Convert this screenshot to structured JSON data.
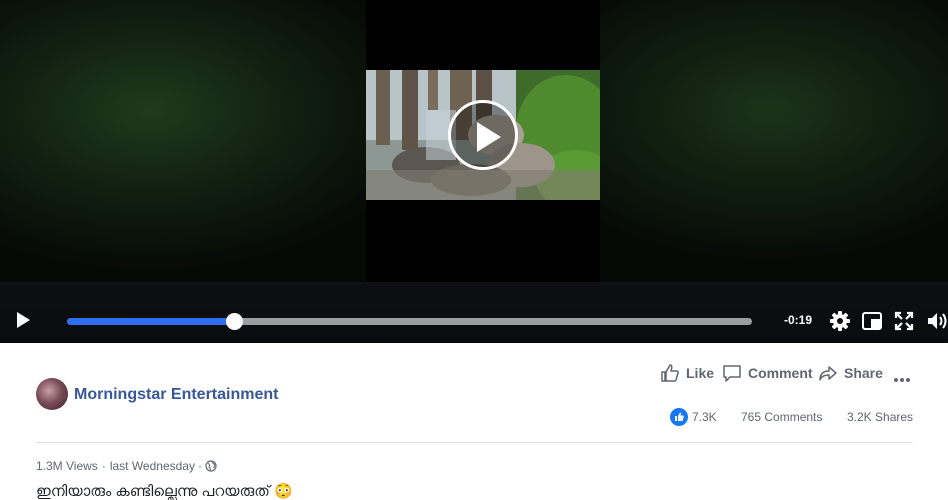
{
  "video": {
    "remaining_time": "-0:19",
    "progress_fraction": 0.244
  },
  "post": {
    "page_name": "Morningstar Entertainment",
    "actions": {
      "like": "Like",
      "comment": "Comment",
      "share": "Share"
    },
    "stats": {
      "reactions": "7.3K",
      "comments": "765 Comments",
      "shares": "3.2K Shares"
    },
    "meta": {
      "views": "1.3M Views",
      "separator": "·",
      "time": "last Wednesday",
      "separator2": "·"
    },
    "caption": "ഇനിയാരും കണ്ടില്ലെന്നു പറയരുത് 😳"
  },
  "colors": {
    "accent": "#2d6ff0",
    "link": "#385898",
    "like_blue": "#1877f2"
  },
  "icons": {
    "play": "play-icon",
    "settings": "gear-icon",
    "pip": "picture-in-picture-icon",
    "fullscreen": "fullscreen-icon",
    "volume": "volume-icon",
    "like": "thumbs-up-icon",
    "comment": "comment-icon",
    "share": "share-icon",
    "privacy": "globe-icon",
    "more": "more-dots-icon"
  }
}
